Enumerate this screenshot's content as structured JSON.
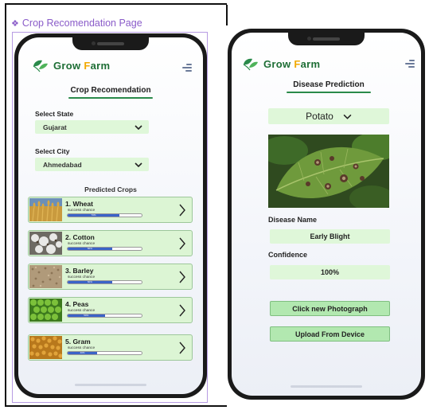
{
  "page_label": "Crop Recomendation Page",
  "brand": {
    "name_prefix": "Grow ",
    "name_f": "F",
    "name_suffix": "arm"
  },
  "crop_page": {
    "title": "Crop Recomendation",
    "state_label": "Select State",
    "state_value": "Gujarat",
    "city_label": "Select City",
    "city_value": "Ahmedabad",
    "predicted_title": "Predicted Crops",
    "crops": [
      {
        "name": "1. Wheat",
        "sub": "success chance",
        "progress": 0.7,
        "progress_label": "70%"
      },
      {
        "name": "2. Cotton",
        "sub": "success chance",
        "progress": 0.6,
        "progress_label": "60%"
      },
      {
        "name": "3. Barley",
        "sub": "success chance",
        "progress": 0.6,
        "progress_label": "60%"
      },
      {
        "name": "4. Peas",
        "sub": "success chance",
        "progress": 0.5,
        "progress_label": "50%"
      },
      {
        "name": "5. Gram",
        "sub": "success chance",
        "progress": 0.4,
        "progress_label": "40%"
      }
    ]
  },
  "disease_page": {
    "title": "Disease Prediction",
    "crop_value": "Potato",
    "disease_label": "Disease Name",
    "disease_value": "Early Blight",
    "confidence_label": "Confidence",
    "confidence_value": "100%",
    "photo_button": "Click new Photograph",
    "upload_button": "Upload From Device"
  },
  "colors": {
    "accent_green": "#2a8a4a",
    "field_bg": "#dff7d9",
    "button_bg": "#b2e8b0",
    "progress_blue": "#3a63c8",
    "label_purple": "#8a5cc9"
  },
  "icons": [
    "diamond-icon",
    "leaf-logo-icon",
    "menu-icon",
    "chevron-down-icon",
    "chevron-right-icon"
  ]
}
